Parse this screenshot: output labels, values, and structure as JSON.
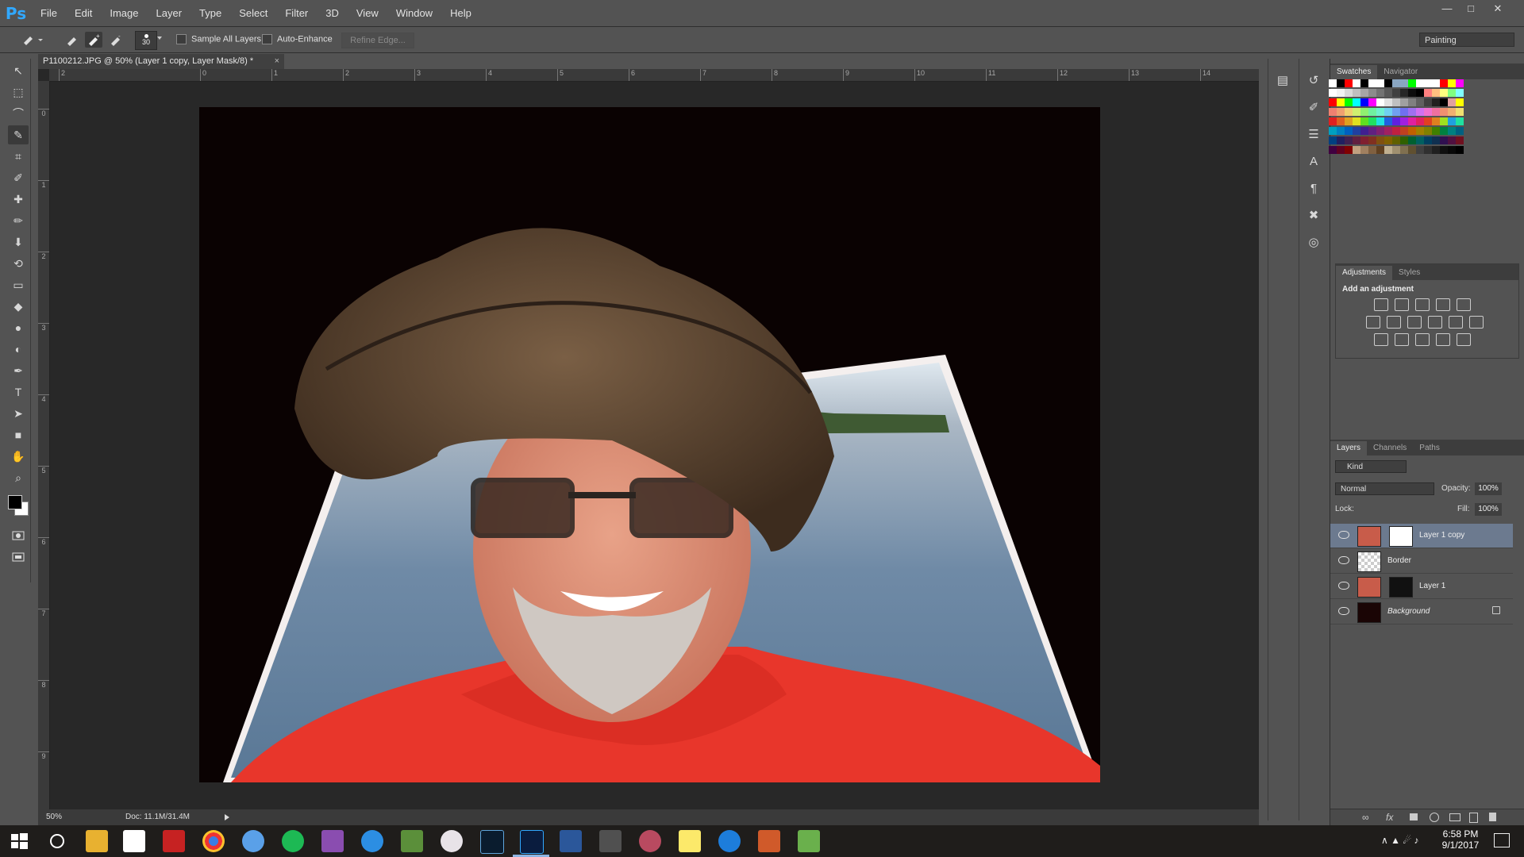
{
  "app": {
    "logo": "Ps"
  },
  "menu": [
    "File",
    "Edit",
    "Image",
    "Layer",
    "Type",
    "Select",
    "Filter",
    "3D",
    "View",
    "Window",
    "Help"
  ],
  "window_controls": {
    "minimize": "—",
    "maximize": "□",
    "close": "✕"
  },
  "options": {
    "brush_size": "30",
    "sample_all_layers": "Sample All Layers",
    "auto_enhance": "Auto-Enhance",
    "refine_edge": "Refine Edge...",
    "workspace": "Painting"
  },
  "document": {
    "tab_title": "P1100212.JPG @ 50% (Layer 1 copy, Layer Mask/8) *",
    "close": "×",
    "zoom": "50%",
    "doc_size": "Doc: 11.1M/31.4M",
    "ruler_h": [
      "2",
      "0",
      "1",
      "2",
      "3",
      "4",
      "5",
      "6",
      "7",
      "8",
      "9",
      "10",
      "11",
      "12",
      "13",
      "14"
    ],
    "ruler_v": [
      "0",
      "1",
      "2",
      "3",
      "4",
      "5",
      "6",
      "7",
      "8",
      "9"
    ]
  },
  "tools": [
    "move-icon",
    "marquee-icon",
    "lasso-icon",
    "quick-selection-icon",
    "crop-icon",
    "eyedropper-icon",
    "healing-brush-icon",
    "brush-icon",
    "clone-stamp-icon",
    "history-brush-icon",
    "eraser-icon",
    "paint-bucket-icon",
    "blur-icon",
    "dodge-icon",
    "pen-icon",
    "type-icon",
    "path-selection-icon",
    "shape-icon",
    "hand-icon",
    "zoom-icon"
  ],
  "tool_glyphs": [
    "↖",
    "⬚",
    "⌒",
    "✎",
    "⌗",
    "✐",
    "✚",
    "✏",
    "⬇",
    "⟲",
    "▭",
    "◆",
    "●",
    "◐",
    "✒",
    "T",
    "➤",
    "■",
    "✋",
    "⌕"
  ],
  "swatches_panel": {
    "tabs": [
      "Swatches",
      "Navigator"
    ]
  },
  "adjustments_panel": {
    "tabs": [
      "Adjustments",
      "Styles"
    ],
    "heading": "Add an adjustment"
  },
  "layers_panel": {
    "tabs": [
      "Layers",
      "Channels",
      "Paths"
    ],
    "filter": "Kind",
    "blend_mode": "Normal",
    "opacity_label": "Opacity:",
    "opacity": "100%",
    "lock_label": "Lock:",
    "fill_label": "Fill:",
    "fill": "100%",
    "layers": [
      {
        "name": "Layer 1 copy",
        "selected": true,
        "mask": true,
        "locked": false,
        "italic": false
      },
      {
        "name": "Border",
        "selected": false,
        "mask": false,
        "locked": false,
        "italic": false
      },
      {
        "name": "Layer 1",
        "selected": false,
        "mask": true,
        "locked": false,
        "italic": false
      },
      {
        "name": "Background",
        "selected": false,
        "mask": false,
        "locked": true,
        "italic": true
      }
    ]
  },
  "taskbar": {
    "time": "6:58 PM",
    "date": "9/1/2017",
    "apps": [
      "start",
      "cortana",
      "file-explorer",
      "store",
      "power",
      "chrome",
      "paint",
      "spotify",
      "app-purple",
      "browser-blue",
      "minecraft",
      "app-pink",
      "lightroom",
      "photoshop",
      "word",
      "game",
      "app-colorful",
      "sticky-notes",
      "edge",
      "app-fruit",
      "app-green"
    ]
  },
  "colors": {
    "panel": "#535353",
    "dark": "#282828",
    "accent": "#31a8ff",
    "selected": "#6c7a8f",
    "shirt": "#e8362b"
  }
}
